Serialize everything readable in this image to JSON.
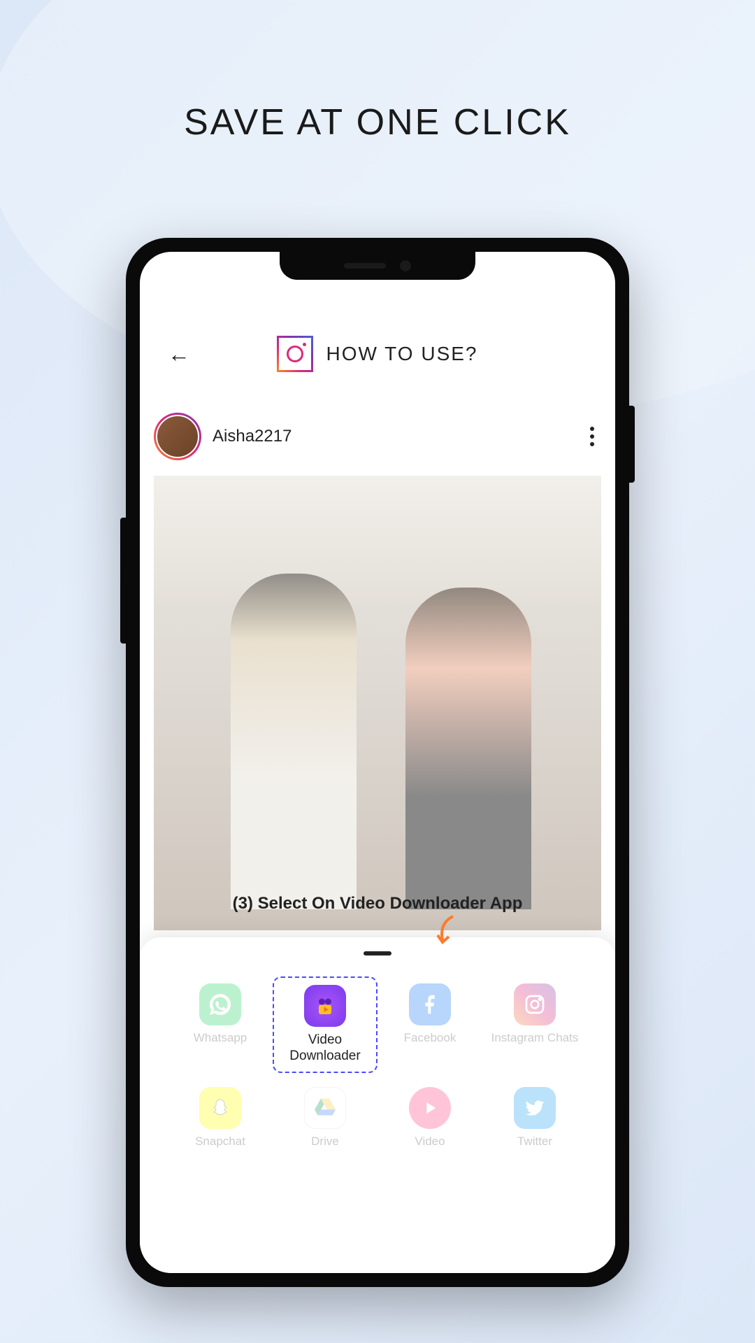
{
  "headline": "SAVE AT ONE CLICK",
  "header": {
    "title": "HOW TO USE?"
  },
  "post": {
    "username": "Aisha2217"
  },
  "instruction": "(3) Select On Video Downloader App",
  "share": {
    "items": [
      {
        "label": "Whatsapp"
      },
      {
        "label": "Video\nDownloader"
      },
      {
        "label": "Facebook"
      },
      {
        "label": "Instagram Chats"
      },
      {
        "label": "Snapchat"
      },
      {
        "label": "Drive"
      },
      {
        "label": "Video"
      },
      {
        "label": "Twitter"
      }
    ]
  }
}
